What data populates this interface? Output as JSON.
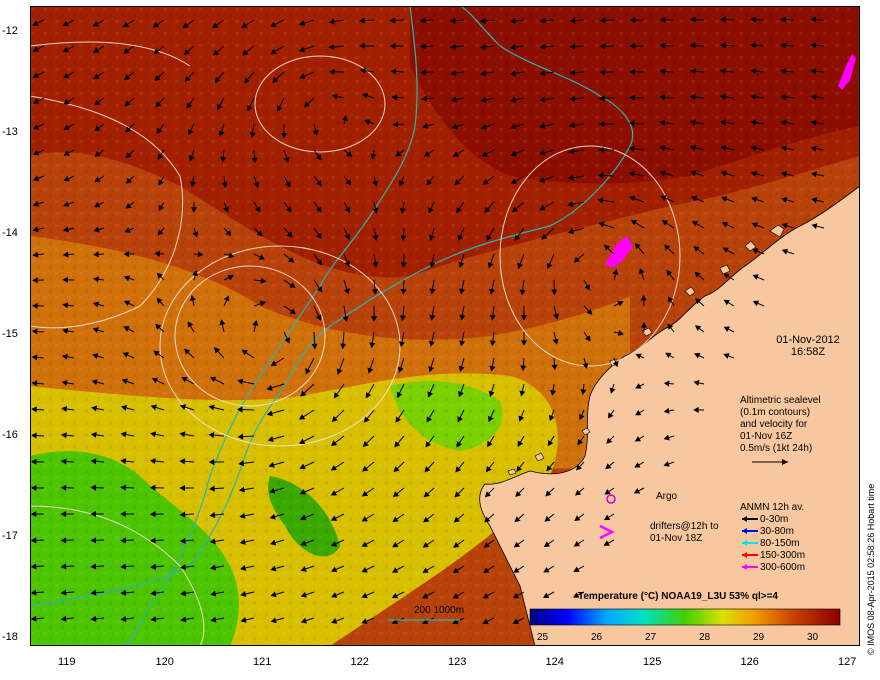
{
  "map": {
    "lat_ticks": [
      "-12",
      "-13",
      "-14",
      "-15",
      "-16",
      "-17",
      "-18"
    ],
    "lon_ticks": [
      "119",
      "120",
      "121",
      "122",
      "123",
      "124",
      "125",
      "126",
      "127"
    ],
    "datetime": {
      "date": "01-Nov-2012",
      "time": "16:58Z"
    },
    "altimetry_note": [
      "Altimetric sealevel",
      "(0.1m contours)",
      "and velocity for",
      "01-Nov 16Z",
      "0.5m/s (1kt 24h)"
    ],
    "argo_label": "Argo",
    "drifters_label": [
      "drifters@12h to",
      "01-Nov 18Z"
    ],
    "anmn": {
      "title": "ANMN 12h av.",
      "items": [
        {
          "label": "0-30m",
          "color": "#000000"
        },
        {
          "label": "30-80m",
          "color": "#0000ff"
        },
        {
          "label": "80-150m",
          "color": "#00e5e5"
        },
        {
          "label": "150-300m",
          "color": "#ff0000"
        },
        {
          "label": "300-600m",
          "color": "#ff00ff"
        }
      ]
    },
    "bathy_label": "200  1000m",
    "colorbar": {
      "title": "Temperature (°C) NOAA19_L3U 53% ql>=4",
      "ticks": [
        "25",
        "26",
        "27",
        "28",
        "29",
        "30"
      ]
    },
    "credit": "© IMOS 08-Apr-2015 02:58:26 Hobart time",
    "colors": {
      "land": "#f7c8a0",
      "warm_sea": "#a61c00",
      "hot_sea": "#7d0800",
      "mid_sea": "#c9560a",
      "cool_sea": "#e8a200",
      "yellow_sea": "#d9d600",
      "green_sea": "#3fc000",
      "isobath": "#2ab3b3",
      "contour": "#f4e7dc"
    }
  }
}
